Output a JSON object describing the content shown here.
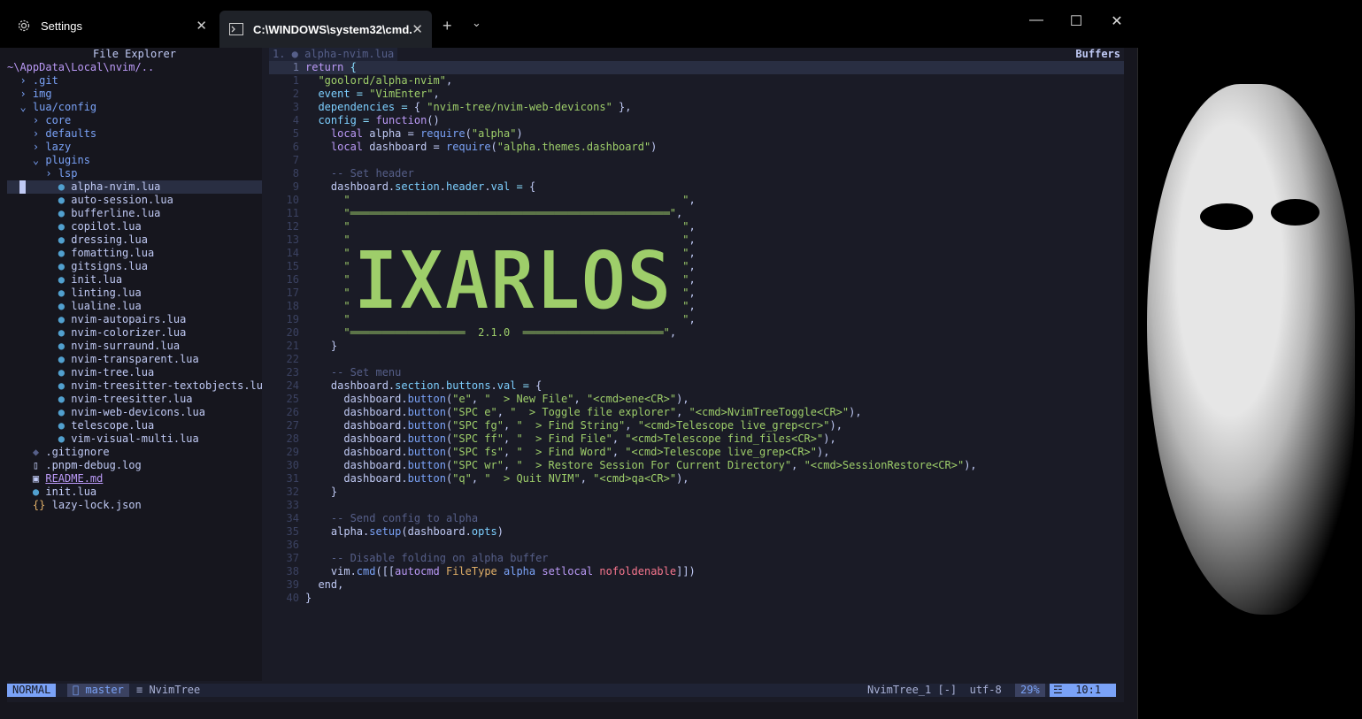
{
  "tabs": {
    "settings_label": "Settings",
    "cmd_label": "C:\\WINDOWS\\system32\\cmd."
  },
  "window_controls": {
    "minimize": "—",
    "maximize": "☐",
    "close": "✕"
  },
  "tree": {
    "title": "File Explorer",
    "root": "~\\AppData\\Local\\nvim/..",
    "rows": [
      {
        "indent": 1,
        "kind": "dir-closed",
        "name": ".git"
      },
      {
        "indent": 1,
        "kind": "dir-closed",
        "name": "img"
      },
      {
        "indent": 1,
        "kind": "dir-open",
        "name": "lua/config"
      },
      {
        "indent": 2,
        "kind": "dir-closed",
        "name": "core"
      },
      {
        "indent": 2,
        "kind": "dir-closed",
        "name": "defaults"
      },
      {
        "indent": 2,
        "kind": "dir-closed",
        "name": "lazy"
      },
      {
        "indent": 2,
        "kind": "dir-open",
        "name": "plugins"
      },
      {
        "indent": 3,
        "kind": "dir-closed",
        "name": "lsp"
      },
      {
        "indent": 4,
        "kind": "lua",
        "name": "alpha-nvim.lua",
        "cursor": true
      },
      {
        "indent": 4,
        "kind": "lua",
        "name": "auto-session.lua"
      },
      {
        "indent": 4,
        "kind": "lua",
        "name": "bufferline.lua"
      },
      {
        "indent": 4,
        "kind": "lua",
        "name": "copilot.lua"
      },
      {
        "indent": 4,
        "kind": "lua",
        "name": "dressing.lua"
      },
      {
        "indent": 4,
        "kind": "lua",
        "name": "fomatting.lua"
      },
      {
        "indent": 4,
        "kind": "lua",
        "name": "gitsigns.lua"
      },
      {
        "indent": 4,
        "kind": "lua",
        "name": "init.lua"
      },
      {
        "indent": 4,
        "kind": "lua",
        "name": "linting.lua"
      },
      {
        "indent": 4,
        "kind": "lua",
        "name": "lualine.lua"
      },
      {
        "indent": 4,
        "kind": "lua",
        "name": "nvim-autopairs.lua"
      },
      {
        "indent": 4,
        "kind": "lua",
        "name": "nvim-colorizer.lua"
      },
      {
        "indent": 4,
        "kind": "lua",
        "name": "nvim-surraund.lua"
      },
      {
        "indent": 4,
        "kind": "lua",
        "name": "nvim-transparent.lua"
      },
      {
        "indent": 4,
        "kind": "lua",
        "name": "nvim-tree.lua"
      },
      {
        "indent": 4,
        "kind": "lua",
        "name": "nvim-treesitter-textobjects.lu"
      },
      {
        "indent": 4,
        "kind": "lua",
        "name": "nvim-treesitter.lua"
      },
      {
        "indent": 4,
        "kind": "lua",
        "name": "nvim-web-devicons.lua"
      },
      {
        "indent": 4,
        "kind": "lua",
        "name": "telescope.lua"
      },
      {
        "indent": 4,
        "kind": "lua",
        "name": "vim-visual-multi.lua"
      },
      {
        "indent": 2,
        "kind": "git",
        "name": ".gitignore"
      },
      {
        "indent": 2,
        "kind": "file",
        "name": ".pnpm-debug.log"
      },
      {
        "indent": 2,
        "kind": "md",
        "name": "README.md"
      },
      {
        "indent": 2,
        "kind": "lua",
        "name": "init.lua"
      },
      {
        "indent": 2,
        "kind": "json",
        "name": "lazy-lock.json"
      }
    ]
  },
  "buffer": {
    "tab_label": "1. ● alpha-nvim.lua",
    "buffers_label": "Buffers"
  },
  "code": {
    "lines": [
      {
        "n": "1",
        "cur": true,
        "t": [
          [
            "kw",
            "return "
          ],
          [
            "op",
            "{"
          ]
        ]
      },
      {
        "n": "1",
        "t": [
          [
            "var",
            "  "
          ],
          [
            "str",
            "\"goolord/alpha-nvim\""
          ],
          [
            "var",
            ","
          ]
        ]
      },
      {
        "n": "2",
        "t": [
          [
            "var",
            "  "
          ],
          [
            "field",
            "event"
          ],
          [
            "op",
            " = "
          ],
          [
            "str",
            "\"VimEnter\""
          ],
          [
            "var",
            ","
          ]
        ]
      },
      {
        "n": "3",
        "t": [
          [
            "var",
            "  "
          ],
          [
            "field",
            "dependencies"
          ],
          [
            "op",
            " = "
          ],
          [
            "var",
            "{ "
          ],
          [
            "str",
            "\"nvim-tree/nvim-web-devicons\""
          ],
          [
            "var",
            " },"
          ]
        ]
      },
      {
        "n": "4",
        "t": [
          [
            "var",
            "  "
          ],
          [
            "field",
            "config"
          ],
          [
            "op",
            " = "
          ],
          [
            "kw",
            "function"
          ],
          [
            "var",
            "()"
          ]
        ]
      },
      {
        "n": "5",
        "t": [
          [
            "var",
            "    "
          ],
          [
            "kw",
            "local "
          ],
          [
            "var",
            "alpha = "
          ],
          [
            "fn",
            "require"
          ],
          [
            "var",
            "("
          ],
          [
            "str",
            "\"alpha\""
          ],
          [
            "var",
            ")"
          ]
        ]
      },
      {
        "n": "6",
        "t": [
          [
            "var",
            "    "
          ],
          [
            "kw",
            "local "
          ],
          [
            "var",
            "dashboard = "
          ],
          [
            "fn",
            "require"
          ],
          [
            "var",
            "("
          ],
          [
            "str",
            "\"alpha.themes.dashboard\""
          ],
          [
            "var",
            ")"
          ]
        ]
      },
      {
        "n": "7",
        "t": []
      },
      {
        "n": "8",
        "t": [
          [
            "cmt",
            "    -- Set header"
          ]
        ]
      },
      {
        "n": "9",
        "t": [
          [
            "var",
            "    dashboard."
          ],
          [
            "field",
            "section"
          ],
          [
            "var",
            "."
          ],
          [
            "field",
            "header"
          ],
          [
            "var",
            "."
          ],
          [
            "field",
            "val"
          ],
          [
            "op",
            " = "
          ],
          [
            "var",
            "{"
          ]
        ]
      },
      {
        "n": "10",
        "t": [
          [
            "str",
            "      \"                                                    \""
          ],
          [
            "var",
            ","
          ]
        ]
      },
      {
        "n": "11",
        "t": [
          [
            "str",
            "      \"══════════════════════════════════════════════════\""
          ],
          [
            "var",
            ","
          ]
        ]
      },
      {
        "n": "12",
        "t": [
          [
            "str",
            "      \"                                                    \""
          ],
          [
            "var",
            ","
          ]
        ]
      },
      {
        "n": "13",
        "t": [
          [
            "str",
            "      \"                                                    \""
          ],
          [
            "var",
            ","
          ]
        ]
      },
      {
        "n": "14",
        "t": [
          [
            "str",
            "      \"                                                    \""
          ],
          [
            "var",
            ","
          ]
        ]
      },
      {
        "n": "15",
        "t": [
          [
            "str",
            "      \"                                                    \""
          ],
          [
            "var",
            ","
          ]
        ]
      },
      {
        "n": "16",
        "t": [
          [
            "str",
            "      \"                                                    \""
          ],
          [
            "var",
            ","
          ]
        ]
      },
      {
        "n": "17",
        "t": [
          [
            "str",
            "      \"                                                    \""
          ],
          [
            "var",
            ","
          ]
        ]
      },
      {
        "n": "18",
        "t": [
          [
            "str",
            "      \"                                                    \""
          ],
          [
            "var",
            ","
          ]
        ]
      },
      {
        "n": "19",
        "t": [
          [
            "str",
            "      \"                                                    \""
          ],
          [
            "var",
            ","
          ]
        ]
      },
      {
        "n": "20",
        "t": [
          [
            "str",
            "      \"══════════════════  2.1.0  ══════════════════════\""
          ],
          [
            "var",
            ","
          ]
        ]
      },
      {
        "n": "21",
        "t": [
          [
            "var",
            "    }"
          ]
        ]
      },
      {
        "n": "22",
        "t": []
      },
      {
        "n": "23",
        "t": [
          [
            "cmt",
            "    -- Set menu"
          ]
        ]
      },
      {
        "n": "24",
        "t": [
          [
            "var",
            "    dashboard."
          ],
          [
            "field",
            "section"
          ],
          [
            "var",
            "."
          ],
          [
            "field",
            "buttons"
          ],
          [
            "var",
            "."
          ],
          [
            "field",
            "val"
          ],
          [
            "op",
            " = "
          ],
          [
            "var",
            "{"
          ]
        ]
      },
      {
        "n": "25",
        "t": [
          [
            "var",
            "      dashboard."
          ],
          [
            "fn",
            "button"
          ],
          [
            "var",
            "("
          ],
          [
            "str",
            "\"e\""
          ],
          [
            "var",
            ", "
          ],
          [
            "str",
            "\"  > New File\""
          ],
          [
            "var",
            ", "
          ],
          [
            "str",
            "\"<cmd>ene<CR>\""
          ],
          [
            "var",
            "),"
          ]
        ]
      },
      {
        "n": "26",
        "t": [
          [
            "var",
            "      dashboard."
          ],
          [
            "fn",
            "button"
          ],
          [
            "var",
            "("
          ],
          [
            "str",
            "\"SPC e\""
          ],
          [
            "var",
            ", "
          ],
          [
            "str",
            "\"  > Toggle file explorer\""
          ],
          [
            "var",
            ", "
          ],
          [
            "str",
            "\"<cmd>NvimTreeToggle<CR>\""
          ],
          [
            "var",
            "),"
          ]
        ]
      },
      {
        "n": "27",
        "t": [
          [
            "var",
            "      dashboard."
          ],
          [
            "fn",
            "button"
          ],
          [
            "var",
            "("
          ],
          [
            "str",
            "\"SPC fg\""
          ],
          [
            "var",
            ", "
          ],
          [
            "str",
            "\"  > Find String\""
          ],
          [
            "var",
            ", "
          ],
          [
            "str",
            "\"<cmd>Telescope live_grep<cr>\""
          ],
          [
            "var",
            "),"
          ]
        ]
      },
      {
        "n": "28",
        "t": [
          [
            "var",
            "      dashboard."
          ],
          [
            "fn",
            "button"
          ],
          [
            "var",
            "("
          ],
          [
            "str",
            "\"SPC ff\""
          ],
          [
            "var",
            ", "
          ],
          [
            "str",
            "\"  > Find File\""
          ],
          [
            "var",
            ", "
          ],
          [
            "str",
            "\"<cmd>Telescope find_files<CR>\""
          ],
          [
            "var",
            "),"
          ]
        ]
      },
      {
        "n": "29",
        "t": [
          [
            "var",
            "      dashboard."
          ],
          [
            "fn",
            "button"
          ],
          [
            "var",
            "("
          ],
          [
            "str",
            "\"SPC fs\""
          ],
          [
            "var",
            ", "
          ],
          [
            "str",
            "\"  > Find Word\""
          ],
          [
            "var",
            ", "
          ],
          [
            "str",
            "\"<cmd>Telescope live_grep<CR>\""
          ],
          [
            "var",
            "),"
          ]
        ]
      },
      {
        "n": "30",
        "t": [
          [
            "var",
            "      dashboard."
          ],
          [
            "fn",
            "button"
          ],
          [
            "var",
            "("
          ],
          [
            "str",
            "\"SPC wr\""
          ],
          [
            "var",
            ", "
          ],
          [
            "str",
            "\"  > Restore Session For Current Directory\""
          ],
          [
            "var",
            ", "
          ],
          [
            "str",
            "\"<cmd>SessionRestore<CR>\""
          ],
          [
            "var",
            "),"
          ]
        ]
      },
      {
        "n": "31",
        "t": [
          [
            "var",
            "      dashboard."
          ],
          [
            "fn",
            "button"
          ],
          [
            "var",
            "("
          ],
          [
            "str",
            "\"q\""
          ],
          [
            "var",
            ", "
          ],
          [
            "str",
            "\"  > Quit NVIM\""
          ],
          [
            "var",
            ", "
          ],
          [
            "str",
            "\"<cmd>qa<CR>\""
          ],
          [
            "var",
            "),"
          ]
        ]
      },
      {
        "n": "32",
        "t": [
          [
            "var",
            "    }"
          ]
        ]
      },
      {
        "n": "33",
        "t": []
      },
      {
        "n": "34",
        "t": [
          [
            "cmt",
            "    -- Send config to alpha"
          ]
        ]
      },
      {
        "n": "35",
        "t": [
          [
            "var",
            "    alpha."
          ],
          [
            "fn",
            "setup"
          ],
          [
            "var",
            "(dashboard."
          ],
          [
            "field",
            "opts"
          ],
          [
            "var",
            ")"
          ]
        ]
      },
      {
        "n": "36",
        "t": []
      },
      {
        "n": "37",
        "t": [
          [
            "cmt",
            "    -- Disable folding on alpha buffer"
          ]
        ]
      },
      {
        "n": "38",
        "t": [
          [
            "var",
            "    vim."
          ],
          [
            "fn",
            "cmd"
          ],
          [
            "var",
            "([["
          ],
          [
            "kw",
            "autocmd "
          ],
          [
            "yel",
            "FileType "
          ],
          [
            "fn",
            "alpha "
          ],
          [
            "kw",
            "setlocal "
          ],
          [
            "red",
            "nofoldenable"
          ],
          [
            "var",
            "]])"
          ]
        ]
      },
      {
        "n": "39",
        "t": [
          [
            "var",
            "  end,"
          ]
        ]
      },
      {
        "n": "40",
        "t": [
          [
            "var",
            "}"
          ]
        ]
      }
    ],
    "banner_text": "IXARLOS"
  },
  "status": {
    "mode": "NORMAL",
    "branch": " master",
    "file": "≡ NvimTree",
    "right": "NvimTree_1 [-]  utf-8",
    "percent": "29%",
    "position": "☲  10:1"
  },
  "colors": {
    "accent": "#7aa2f7",
    "background": "#1a1b26",
    "string": "#9ece6a"
  }
}
